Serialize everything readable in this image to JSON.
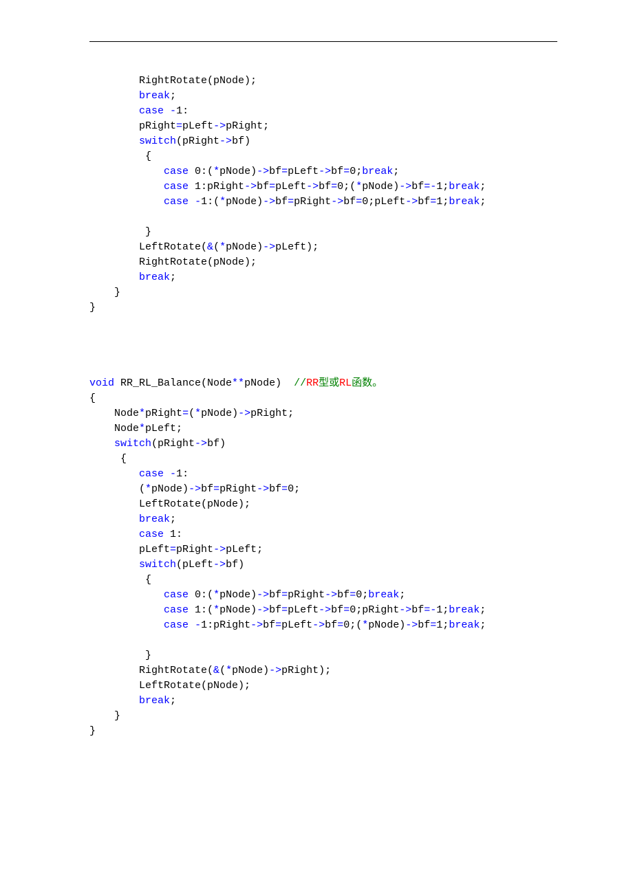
{
  "code": {
    "lines": [
      {
        "indent": 8,
        "tokens": [
          {
            "t": "RightRotate(pNode);",
            "c": "blk"
          }
        ]
      },
      {
        "indent": 8,
        "tokens": [
          {
            "t": "break",
            "c": "kw"
          },
          {
            "t": ";",
            "c": "blk"
          }
        ]
      },
      {
        "indent": 8,
        "tokens": [
          {
            "t": "case",
            "c": "kw"
          },
          {
            "t": " ",
            "c": "blk"
          },
          {
            "t": "-",
            "c": "op"
          },
          {
            "t": "1:",
            "c": "blk"
          }
        ]
      },
      {
        "indent": 8,
        "tokens": [
          {
            "t": "pRight",
            "c": "blk"
          },
          {
            "t": "=",
            "c": "op"
          },
          {
            "t": "pLeft",
            "c": "blk"
          },
          {
            "t": "->",
            "c": "op"
          },
          {
            "t": "pRight;",
            "c": "blk"
          }
        ]
      },
      {
        "indent": 8,
        "tokens": [
          {
            "t": "switch",
            "c": "kw"
          },
          {
            "t": "(pRight",
            "c": "blk"
          },
          {
            "t": "->",
            "c": "op"
          },
          {
            "t": "bf)",
            "c": "blk"
          }
        ]
      },
      {
        "indent": 9,
        "tokens": [
          {
            "t": "{",
            "c": "blk"
          }
        ]
      },
      {
        "indent": 12,
        "tokens": [
          {
            "t": "case",
            "c": "kw"
          },
          {
            "t": " 0:(",
            "c": "blk"
          },
          {
            "t": "*",
            "c": "op"
          },
          {
            "t": "pNode)",
            "c": "blk"
          },
          {
            "t": "->",
            "c": "op"
          },
          {
            "t": "bf",
            "c": "blk"
          },
          {
            "t": "=",
            "c": "op"
          },
          {
            "t": "pLeft",
            "c": "blk"
          },
          {
            "t": "->",
            "c": "op"
          },
          {
            "t": "bf",
            "c": "blk"
          },
          {
            "t": "=",
            "c": "op"
          },
          {
            "t": "0;",
            "c": "blk"
          },
          {
            "t": "break",
            "c": "kw"
          },
          {
            "t": ";",
            "c": "blk"
          }
        ]
      },
      {
        "indent": 12,
        "tokens": [
          {
            "t": "case",
            "c": "kw"
          },
          {
            "t": " 1:pRight",
            "c": "blk"
          },
          {
            "t": "->",
            "c": "op"
          },
          {
            "t": "bf",
            "c": "blk"
          },
          {
            "t": "=",
            "c": "op"
          },
          {
            "t": "pLeft",
            "c": "blk"
          },
          {
            "t": "->",
            "c": "op"
          },
          {
            "t": "bf",
            "c": "blk"
          },
          {
            "t": "=",
            "c": "op"
          },
          {
            "t": "0;(",
            "c": "blk"
          },
          {
            "t": "*",
            "c": "op"
          },
          {
            "t": "pNode)",
            "c": "blk"
          },
          {
            "t": "->",
            "c": "op"
          },
          {
            "t": "bf",
            "c": "blk"
          },
          {
            "t": "=-",
            "c": "op"
          },
          {
            "t": "1;",
            "c": "blk"
          },
          {
            "t": "break",
            "c": "kw"
          },
          {
            "t": ";",
            "c": "blk"
          }
        ]
      },
      {
        "indent": 12,
        "tokens": [
          {
            "t": "case",
            "c": "kw"
          },
          {
            "t": " ",
            "c": "blk"
          },
          {
            "t": "-",
            "c": "op"
          },
          {
            "t": "1:(",
            "c": "blk"
          },
          {
            "t": "*",
            "c": "op"
          },
          {
            "t": "pNode)",
            "c": "blk"
          },
          {
            "t": "->",
            "c": "op"
          },
          {
            "t": "bf",
            "c": "blk"
          },
          {
            "t": "=",
            "c": "op"
          },
          {
            "t": "pRight",
            "c": "blk"
          },
          {
            "t": "->",
            "c": "op"
          },
          {
            "t": "bf",
            "c": "blk"
          },
          {
            "t": "=",
            "c": "op"
          },
          {
            "t": "0;pLeft",
            "c": "blk"
          },
          {
            "t": "->",
            "c": "op"
          },
          {
            "t": "bf",
            "c": "blk"
          },
          {
            "t": "=",
            "c": "op"
          },
          {
            "t": "1;",
            "c": "blk"
          },
          {
            "t": "break",
            "c": "kw"
          },
          {
            "t": ";",
            "c": "blk"
          }
        ]
      },
      {
        "indent": 0,
        "tokens": []
      },
      {
        "indent": 9,
        "tokens": [
          {
            "t": "}",
            "c": "blk"
          }
        ]
      },
      {
        "indent": 8,
        "tokens": [
          {
            "t": "LeftRotate(",
            "c": "blk"
          },
          {
            "t": "&",
            "c": "op"
          },
          {
            "t": "(",
            "c": "blk"
          },
          {
            "t": "*",
            "c": "op"
          },
          {
            "t": "pNode)",
            "c": "blk"
          },
          {
            "t": "->",
            "c": "op"
          },
          {
            "t": "pLeft);",
            "c": "blk"
          }
        ]
      },
      {
        "indent": 8,
        "tokens": [
          {
            "t": "RightRotate(pNode);",
            "c": "blk"
          }
        ]
      },
      {
        "indent": 8,
        "tokens": [
          {
            "t": "break",
            "c": "kw"
          },
          {
            "t": ";",
            "c": "blk"
          }
        ]
      },
      {
        "indent": 4,
        "tokens": [
          {
            "t": "}",
            "c": "blk"
          }
        ]
      },
      {
        "indent": 0,
        "tokens": [
          {
            "t": "}",
            "c": "blk"
          }
        ]
      },
      {
        "indent": 0,
        "tokens": []
      },
      {
        "indent": 0,
        "tokens": []
      },
      {
        "indent": 0,
        "tokens": []
      },
      {
        "indent": 0,
        "tokens": []
      },
      {
        "indent": 0,
        "tokens": [
          {
            "t": "void",
            "c": "kw"
          },
          {
            "t": " RR_RL_Balance(Node",
            "c": "blk"
          },
          {
            "t": "**",
            "c": "op"
          },
          {
            "t": "pNode)  ",
            "c": "blk"
          },
          {
            "t": "//",
            "c": "cm"
          },
          {
            "t": "RR",
            "c": "cmop"
          },
          {
            "t": "型或",
            "c": "cm"
          },
          {
            "t": "RL",
            "c": "cmop"
          },
          {
            "t": "函数。",
            "c": "cm"
          }
        ]
      },
      {
        "indent": 0,
        "tokens": [
          {
            "t": "{",
            "c": "blk"
          }
        ]
      },
      {
        "indent": 4,
        "tokens": [
          {
            "t": "Node",
            "c": "blk"
          },
          {
            "t": "*",
            "c": "op"
          },
          {
            "t": "pRight",
            "c": "blk"
          },
          {
            "t": "=",
            "c": "op"
          },
          {
            "t": "(",
            "c": "blk"
          },
          {
            "t": "*",
            "c": "op"
          },
          {
            "t": "pNode)",
            "c": "blk"
          },
          {
            "t": "->",
            "c": "op"
          },
          {
            "t": "pRight;",
            "c": "blk"
          }
        ]
      },
      {
        "indent": 4,
        "tokens": [
          {
            "t": "Node",
            "c": "blk"
          },
          {
            "t": "*",
            "c": "op"
          },
          {
            "t": "pLeft;",
            "c": "blk"
          }
        ]
      },
      {
        "indent": 4,
        "tokens": [
          {
            "t": "switch",
            "c": "kw"
          },
          {
            "t": "(pRight",
            "c": "blk"
          },
          {
            "t": "->",
            "c": "op"
          },
          {
            "t": "bf)",
            "c": "blk"
          }
        ]
      },
      {
        "indent": 5,
        "tokens": [
          {
            "t": "{",
            "c": "blk"
          }
        ]
      },
      {
        "indent": 8,
        "tokens": [
          {
            "t": "case",
            "c": "kw"
          },
          {
            "t": " ",
            "c": "blk"
          },
          {
            "t": "-",
            "c": "op"
          },
          {
            "t": "1:",
            "c": "blk"
          }
        ]
      },
      {
        "indent": 8,
        "tokens": [
          {
            "t": "(",
            "c": "blk"
          },
          {
            "t": "*",
            "c": "op"
          },
          {
            "t": "pNode)",
            "c": "blk"
          },
          {
            "t": "->",
            "c": "op"
          },
          {
            "t": "bf",
            "c": "blk"
          },
          {
            "t": "=",
            "c": "op"
          },
          {
            "t": "pRight",
            "c": "blk"
          },
          {
            "t": "->",
            "c": "op"
          },
          {
            "t": "bf",
            "c": "blk"
          },
          {
            "t": "=",
            "c": "op"
          },
          {
            "t": "0;",
            "c": "blk"
          }
        ]
      },
      {
        "indent": 8,
        "tokens": [
          {
            "t": "LeftRotate(pNode);",
            "c": "blk"
          }
        ]
      },
      {
        "indent": 8,
        "tokens": [
          {
            "t": "break",
            "c": "kw"
          },
          {
            "t": ";",
            "c": "blk"
          }
        ]
      },
      {
        "indent": 8,
        "tokens": [
          {
            "t": "case",
            "c": "kw"
          },
          {
            "t": " 1:",
            "c": "blk"
          }
        ]
      },
      {
        "indent": 8,
        "tokens": [
          {
            "t": "pLeft",
            "c": "blk"
          },
          {
            "t": "=",
            "c": "op"
          },
          {
            "t": "pRight",
            "c": "blk"
          },
          {
            "t": "->",
            "c": "op"
          },
          {
            "t": "pLeft;",
            "c": "blk"
          }
        ]
      },
      {
        "indent": 8,
        "tokens": [
          {
            "t": "switch",
            "c": "kw"
          },
          {
            "t": "(pLeft",
            "c": "blk"
          },
          {
            "t": "->",
            "c": "op"
          },
          {
            "t": "bf)",
            "c": "blk"
          }
        ]
      },
      {
        "indent": 9,
        "tokens": [
          {
            "t": "{",
            "c": "blk"
          }
        ]
      },
      {
        "indent": 12,
        "tokens": [
          {
            "t": "case",
            "c": "kw"
          },
          {
            "t": " 0:(",
            "c": "blk"
          },
          {
            "t": "*",
            "c": "op"
          },
          {
            "t": "pNode)",
            "c": "blk"
          },
          {
            "t": "->",
            "c": "op"
          },
          {
            "t": "bf",
            "c": "blk"
          },
          {
            "t": "=",
            "c": "op"
          },
          {
            "t": "pRight",
            "c": "blk"
          },
          {
            "t": "->",
            "c": "op"
          },
          {
            "t": "bf",
            "c": "blk"
          },
          {
            "t": "=",
            "c": "op"
          },
          {
            "t": "0;",
            "c": "blk"
          },
          {
            "t": "break",
            "c": "kw"
          },
          {
            "t": ";",
            "c": "blk"
          }
        ]
      },
      {
        "indent": 12,
        "tokens": [
          {
            "t": "case",
            "c": "kw"
          },
          {
            "t": " 1:(",
            "c": "blk"
          },
          {
            "t": "*",
            "c": "op"
          },
          {
            "t": "pNode)",
            "c": "blk"
          },
          {
            "t": "->",
            "c": "op"
          },
          {
            "t": "bf",
            "c": "blk"
          },
          {
            "t": "=",
            "c": "op"
          },
          {
            "t": "pLeft",
            "c": "blk"
          },
          {
            "t": "->",
            "c": "op"
          },
          {
            "t": "bf",
            "c": "blk"
          },
          {
            "t": "=",
            "c": "op"
          },
          {
            "t": "0;pRight",
            "c": "blk"
          },
          {
            "t": "->",
            "c": "op"
          },
          {
            "t": "bf",
            "c": "blk"
          },
          {
            "t": "=-",
            "c": "op"
          },
          {
            "t": "1;",
            "c": "blk"
          },
          {
            "t": "break",
            "c": "kw"
          },
          {
            "t": ";",
            "c": "blk"
          }
        ]
      },
      {
        "indent": 12,
        "tokens": [
          {
            "t": "case",
            "c": "kw"
          },
          {
            "t": " ",
            "c": "blk"
          },
          {
            "t": "-",
            "c": "op"
          },
          {
            "t": "1:pRight",
            "c": "blk"
          },
          {
            "t": "->",
            "c": "op"
          },
          {
            "t": "bf",
            "c": "blk"
          },
          {
            "t": "=",
            "c": "op"
          },
          {
            "t": "pLeft",
            "c": "blk"
          },
          {
            "t": "->",
            "c": "op"
          },
          {
            "t": "bf",
            "c": "blk"
          },
          {
            "t": "=",
            "c": "op"
          },
          {
            "t": "0;(",
            "c": "blk"
          },
          {
            "t": "*",
            "c": "op"
          },
          {
            "t": "pNode)",
            "c": "blk"
          },
          {
            "t": "->",
            "c": "op"
          },
          {
            "t": "bf",
            "c": "blk"
          },
          {
            "t": "=",
            "c": "op"
          },
          {
            "t": "1;",
            "c": "blk"
          },
          {
            "t": "break",
            "c": "kw"
          },
          {
            "t": ";",
            "c": "blk"
          }
        ]
      },
      {
        "indent": 0,
        "tokens": []
      },
      {
        "indent": 9,
        "tokens": [
          {
            "t": "}",
            "c": "blk"
          }
        ]
      },
      {
        "indent": 8,
        "tokens": [
          {
            "t": "RightRotate(",
            "c": "blk"
          },
          {
            "t": "&",
            "c": "op"
          },
          {
            "t": "(",
            "c": "blk"
          },
          {
            "t": "*",
            "c": "op"
          },
          {
            "t": "pNode)",
            "c": "blk"
          },
          {
            "t": "->",
            "c": "op"
          },
          {
            "t": "pRight);",
            "c": "blk"
          }
        ]
      },
      {
        "indent": 8,
        "tokens": [
          {
            "t": "LeftRotate(pNode);",
            "c": "blk"
          }
        ]
      },
      {
        "indent": 8,
        "tokens": [
          {
            "t": "break",
            "c": "kw"
          },
          {
            "t": ";",
            "c": "blk"
          }
        ]
      },
      {
        "indent": 4,
        "tokens": [
          {
            "t": "}",
            "c": "blk"
          }
        ]
      },
      {
        "indent": 0,
        "tokens": [
          {
            "t": "}",
            "c": "blk"
          }
        ]
      }
    ]
  }
}
